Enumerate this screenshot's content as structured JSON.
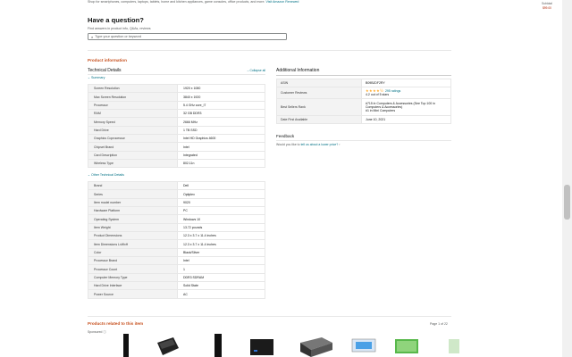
{
  "top_note": {
    "text": "Shop for smartphones, computers, laptops, tablets, home and kitchen appliances, game consoles, office products, and more.",
    "link": "Visit Amazon Renewed"
  },
  "question": {
    "heading": "Have a question?",
    "sub": "Find answers in product info, Q&As, reviews",
    "placeholder": "Type your question or keyword"
  },
  "product_info": {
    "title": "Product information",
    "technical_details": "Technical Details",
    "collapse": "Collapse all",
    "summary_label": "Summary",
    "other_label": "Other Technical Details",
    "summary": [
      {
        "k": "Screen Resolution",
        "v": "1920 x 1080"
      },
      {
        "k": "Max Screen Resolution",
        "v": "3840 x 1920"
      },
      {
        "k": "Processor",
        "v": "5.4 GHz core_i7"
      },
      {
        "k": "RAM",
        "v": "32 GB DDR3"
      },
      {
        "k": "Memory Speed",
        "v": "2666 MHz"
      },
      {
        "k": "Hard Drive",
        "v": "1 TB SSD"
      },
      {
        "k": "Graphics Coprocessor",
        "v": "Intel HD Graphics 4600"
      },
      {
        "k": "Chipset Brand",
        "v": "Intel"
      },
      {
        "k": "Card Description",
        "v": "Integrated"
      },
      {
        "k": "Wireless Type",
        "v": "802.11n"
      }
    ],
    "other": [
      {
        "k": "Brand",
        "v": "Dell"
      },
      {
        "k": "Series",
        "v": "Optiplex"
      },
      {
        "k": "Item model number",
        "v": "9020"
      },
      {
        "k": "Hardware Platform",
        "v": "PC"
      },
      {
        "k": "Operating System",
        "v": "Windows 10"
      },
      {
        "k": "Item Weight",
        "v": "13.72 pounds"
      },
      {
        "k": "Product Dimensions",
        "v": "12.3 x 3.7 x 11.4 inches"
      },
      {
        "k": "Item Dimensions LxWxH",
        "v": "12.3 x 3.7 x 11.4 inches"
      },
      {
        "k": "Color",
        "v": "Black/Silver"
      },
      {
        "k": "Processor Brand",
        "v": "Intel"
      },
      {
        "k": "Processor Count",
        "v": "1"
      },
      {
        "k": "Computer Memory Type",
        "v": "DDR3 SDRAM"
      },
      {
        "k": "Hard Drive Interface",
        "v": "Solid State"
      },
      {
        "k": "Power Source",
        "v": "AC"
      }
    ]
  },
  "additional": {
    "title": "Additional Information",
    "asin_k": "ASIN",
    "asin_v": "B09BJDF2RY",
    "reviews_k": "Customer Reviews",
    "stars": "★★★★½",
    "ratings": "295 ratings",
    "rating_text": "4.2 out of 5 stars",
    "bsr_k": "Best Sellers Rank",
    "bsr_1": "#715 in Computers & Accessories (See Top 100 in Computers & Accessories)",
    "bsr_2": "#1 in Mini Computers",
    "date_k": "Date First Available",
    "date_v": "June 10, 2021"
  },
  "feedback": {
    "title": "Feedback",
    "q_prefix": "Would you like to",
    "q_link": "tell us about a lower price?",
    "q_suffix": "›"
  },
  "related": {
    "title": "Products related to this item",
    "page": "Page 1 of 22",
    "sponsored": "Sponsored"
  },
  "side_panel": {
    "line1": "Subtotal",
    "line2": "$99.00"
  }
}
